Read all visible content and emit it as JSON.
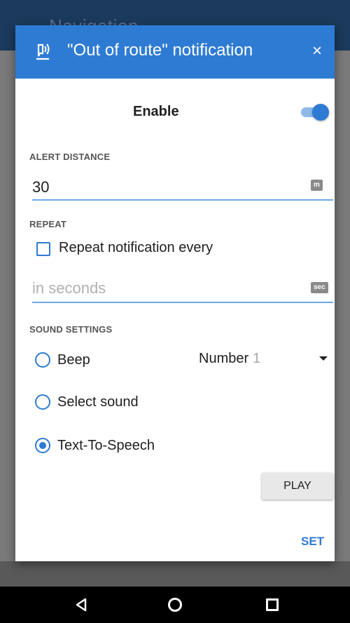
{
  "background": {
    "appbar_title": "Navigation"
  },
  "dialog": {
    "title": "\"Out of route\" notification",
    "close_label": "×",
    "header_color": "#2e7bd4"
  },
  "enable": {
    "label": "Enable",
    "checked": true
  },
  "alert_distance": {
    "section_label": "ALERT DISTANCE",
    "value": "30",
    "unit": "m"
  },
  "repeat": {
    "section_label": "REPEAT",
    "checkbox_label": "Repeat notification every",
    "checked": false,
    "placeholder": "in seconds",
    "unit": "sec"
  },
  "sound_settings": {
    "section_label": "SOUND SETTINGS",
    "options": [
      {
        "label": "Beep",
        "selected": false
      },
      {
        "label": "Select sound",
        "selected": false
      },
      {
        "label": "Text-To-Speech",
        "selected": true
      }
    ],
    "number_label": "Number",
    "number_value": "1",
    "play_label": "PLAY"
  },
  "actions": {
    "set_label": "SET"
  },
  "icons": {
    "header": "tts-notification-icon",
    "close": "close-icon",
    "nav_back": "back-icon",
    "nav_home": "home-icon",
    "nav_recent": "recent-apps-icon"
  }
}
